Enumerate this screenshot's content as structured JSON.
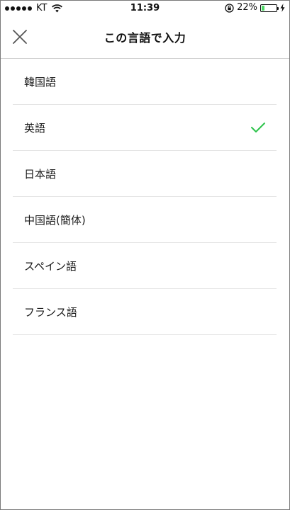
{
  "status_bar": {
    "carrier": "KT",
    "time": "11:39",
    "battery_percent": "22%",
    "battery_level": 0.22,
    "battery_color": "#4cd964"
  },
  "header": {
    "title": "この言語で入力",
    "close_icon": "close-icon"
  },
  "languages": {
    "items": [
      {
        "label": "韓国語",
        "selected": false
      },
      {
        "label": "英語",
        "selected": true
      },
      {
        "label": "日本語",
        "selected": false
      },
      {
        "label": "中国語(簡体)",
        "selected": false
      },
      {
        "label": "スペイン語",
        "selected": false
      },
      {
        "label": "フランス語",
        "selected": false
      }
    ],
    "check_color": "#2dc34b"
  }
}
